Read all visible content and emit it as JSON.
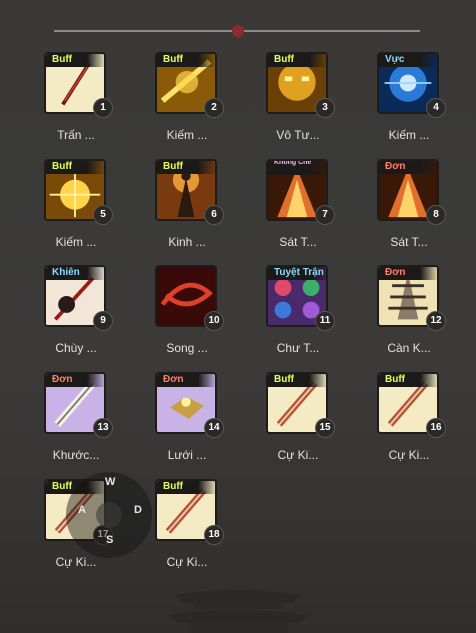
{
  "skills": [
    {
      "tag": "Buff",
      "tag_color": "yellow",
      "number": "1",
      "label": "Trấn ...",
      "art": "sword-skill",
      "bg": "#f4eac4"
    },
    {
      "tag": "Buff",
      "tag_color": "yellow",
      "number": "2",
      "label": "Kiếm ...",
      "art": "golden-slash",
      "bg": "#c88b18"
    },
    {
      "tag": "Buff",
      "tag_color": "yellow",
      "number": "3",
      "label": "Vô Tư...",
      "art": "golden-face",
      "bg": "#b07a12"
    },
    {
      "tag": "Vực",
      "tag_color": "blue",
      "number": "4",
      "label": "Kiếm ...",
      "art": "blue-vortex",
      "bg": "#1a5ea8"
    },
    {
      "tag": "Buff",
      "tag_color": "yellow",
      "number": "5",
      "label": "Kiếm ...",
      "art": "golden-burst",
      "bg": "#c88b18"
    },
    {
      "tag": "Buff",
      "tag_color": "yellow",
      "number": "6",
      "label": "Kinh ...",
      "art": "warrior-aura",
      "bg": "#b86a20"
    },
    {
      "tag": "Khống Chế",
      "tag_color": "purple",
      "number": "7",
      "label": "Sát T...",
      "art": "fire-demon",
      "bg": "#a84a18"
    },
    {
      "tag": "Đơn",
      "tag_color": "red",
      "number": "8",
      "label": "Sát T...",
      "art": "fire-demon",
      "bg": "#a84a18"
    },
    {
      "tag": "Khiên",
      "tag_color": "blue",
      "number": "9",
      "label": "Chùy ...",
      "art": "red-mace",
      "bg": "#f2e6d8"
    },
    {
      "tag": "",
      "tag_color": "yellow",
      "number": "10",
      "label": "Song ...",
      "art": "red-swirl",
      "bg": "#8a1a10"
    },
    {
      "tag": "Tuyệt Trận",
      "tag_color": "blue",
      "number": "11",
      "label": "Chư T...",
      "art": "orbs",
      "bg": "#7a4aa0"
    },
    {
      "tag": "Đơn",
      "tag_color": "red",
      "number": "12",
      "label": "Càn K...",
      "art": "pagoda",
      "bg": "#f1e2b4"
    },
    {
      "tag": "Đơn",
      "tag_color": "red",
      "number": "13",
      "label": "Khước...",
      "art": "greatsword",
      "bg": "#c9b2e6"
    },
    {
      "tag": "Đơn",
      "tag_color": "red",
      "number": "14",
      "label": "Lưới ...",
      "art": "golden-box",
      "bg": "#c9b2e6"
    },
    {
      "tag": "Buff",
      "tag_color": "yellow",
      "number": "15",
      "label": "Cự Ki...",
      "art": "jagged-sword",
      "bg": "#f4eac4"
    },
    {
      "tag": "Buff",
      "tag_color": "yellow",
      "number": "16",
      "label": "Cự Ki...",
      "art": "jagged-sword",
      "bg": "#f4eac4"
    },
    {
      "tag": "Buff",
      "tag_color": "yellow",
      "number": "17",
      "label": "Cự Ki...",
      "art": "jagged-sword",
      "bg": "#f4eac4"
    },
    {
      "tag": "Buff",
      "tag_color": "yellow",
      "number": "18",
      "label": "Cự Ki...",
      "art": "jagged-sword",
      "bg": "#f4eac4"
    }
  ],
  "joystick": {
    "up": "W",
    "left": "A",
    "right": "D",
    "down": "S"
  },
  "colors": {
    "accent": "#8f2a2a",
    "tag_yellow": "#e6ff5a",
    "tag_red": "#ff7f6a",
    "tag_blue": "#8fd8ff"
  }
}
